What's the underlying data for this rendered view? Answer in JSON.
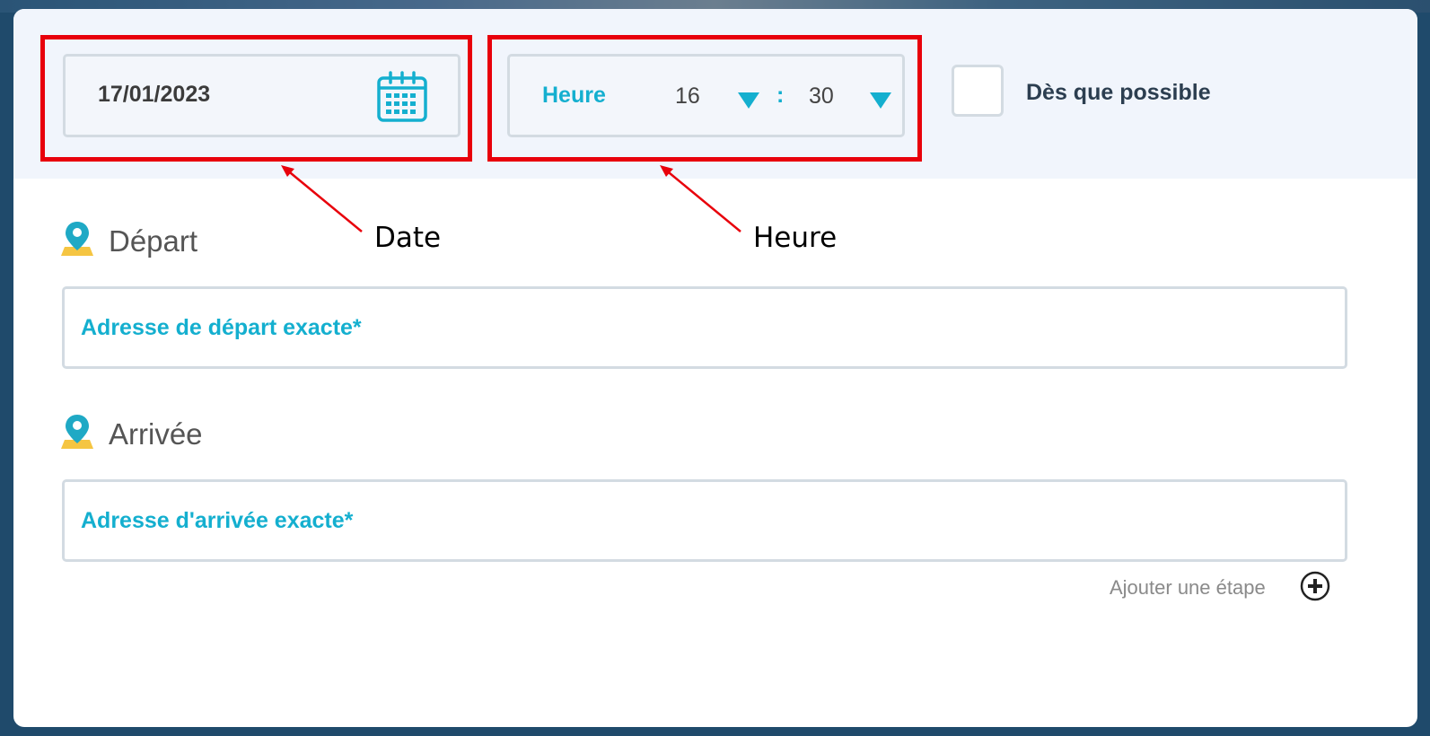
{
  "form": {
    "date": {
      "value": "17/01/2023",
      "icon": "calendar-icon"
    },
    "time": {
      "label": "Heure",
      "hour": "16",
      "separator": ":",
      "minute": "30"
    },
    "asap": {
      "label": "Dès que possible",
      "checked": false
    },
    "departure": {
      "title": "Départ",
      "placeholder": "Adresse de départ exacte*"
    },
    "arrival": {
      "title": "Arrivée",
      "placeholder": "Adresse d'arrivée exacte*"
    },
    "add_step": {
      "label": "Ajouter une étape",
      "icon": "plus-circle-icon"
    }
  },
  "annotations": {
    "date": "Date",
    "time": "Heure"
  },
  "colors": {
    "accent": "#14afcf",
    "highlight": "#e8000b",
    "pin_yellow": "#f5c542",
    "pin_teal": "#1fa9c5"
  }
}
